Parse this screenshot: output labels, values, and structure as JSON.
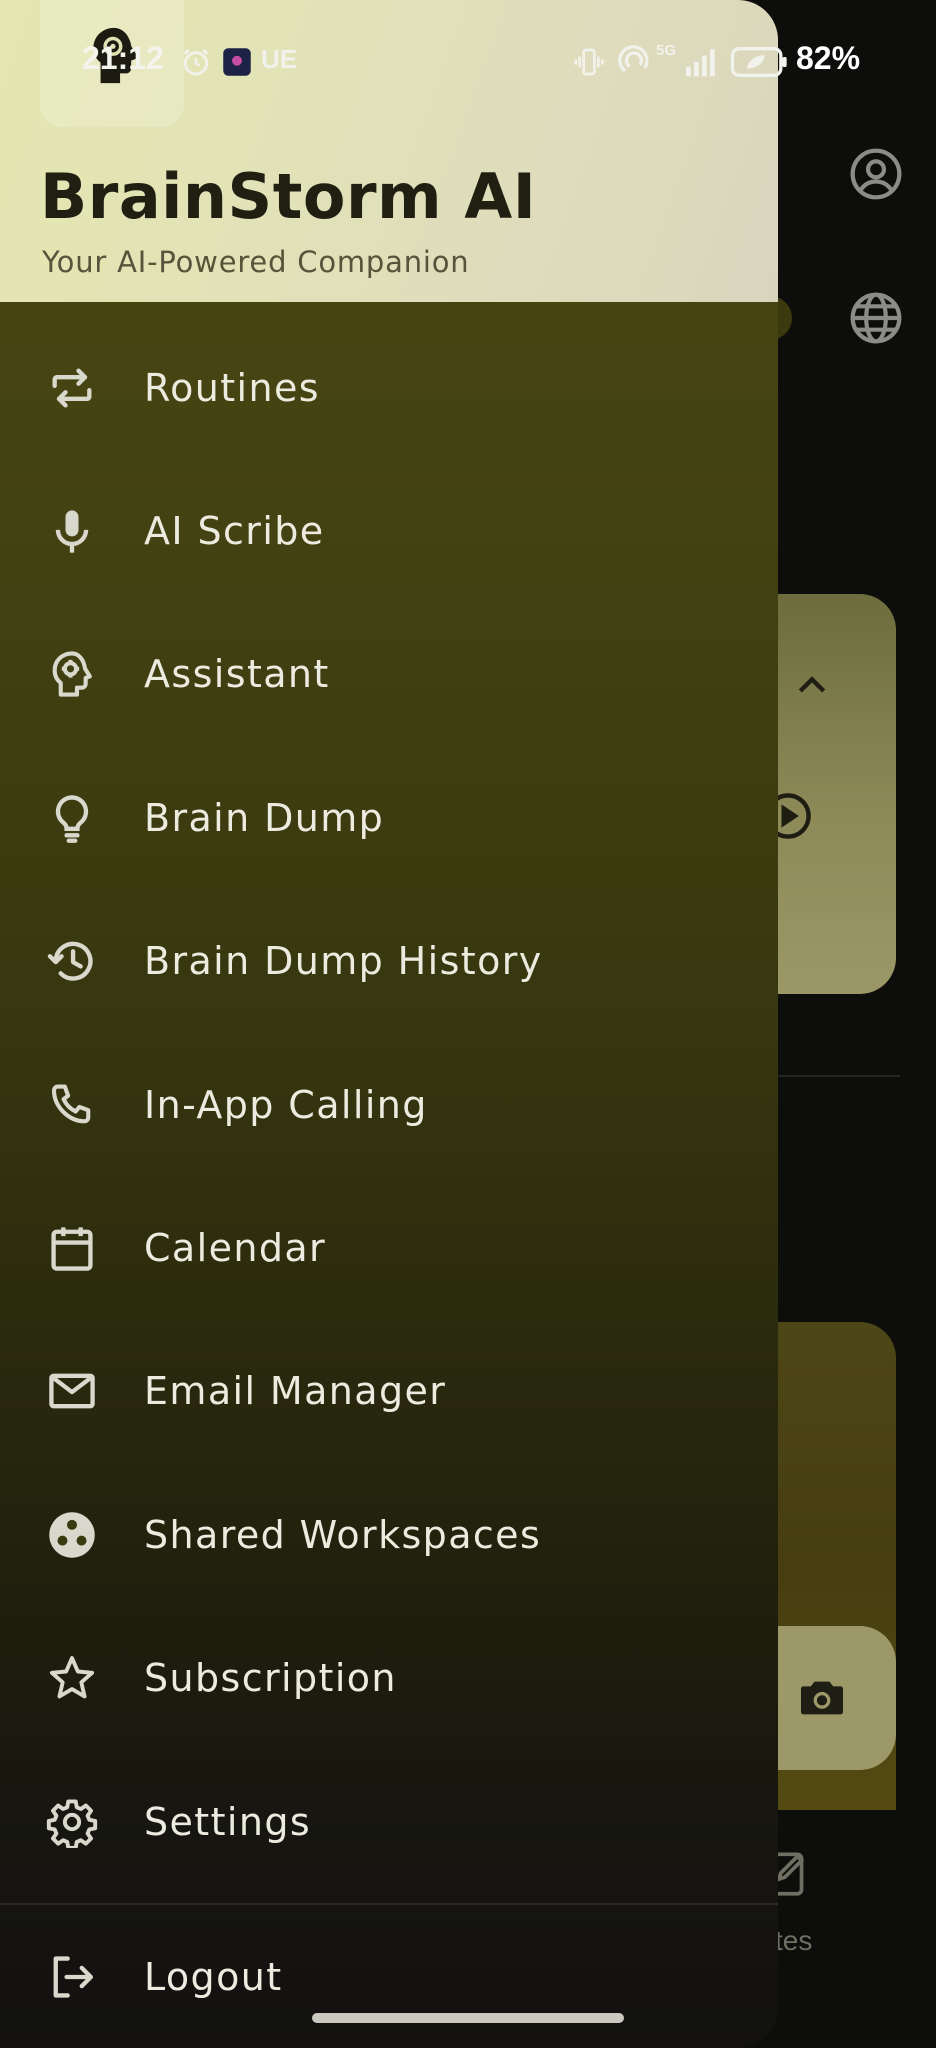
{
  "status_bar": {
    "time": "21:12",
    "carrier_tag": "UE",
    "network": "5G",
    "battery": "82%"
  },
  "drawer": {
    "brand_title": "BrainStorm AI",
    "brand_subtitle": "Your AI-Powered Companion",
    "menu_items": [
      {
        "label": "Routines",
        "icon": "repeat-icon"
      },
      {
        "label": "AI Scribe",
        "icon": "microphone-icon"
      },
      {
        "label": "Assistant",
        "icon": "brain-head-icon"
      },
      {
        "label": "Brain Dump",
        "icon": "lightbulb-icon"
      },
      {
        "label": "Brain Dump History",
        "icon": "history-icon"
      },
      {
        "label": "In-App Calling",
        "icon": "phone-icon"
      },
      {
        "label": "Calendar",
        "icon": "calendar-icon"
      },
      {
        "label": "Email Manager",
        "icon": "mail-icon"
      },
      {
        "label": "Shared Workspaces",
        "icon": "workspaces-icon"
      },
      {
        "label": "Subscription",
        "icon": "star-icon"
      },
      {
        "label": "Settings",
        "icon": "gear-icon"
      }
    ],
    "logout_label": "Logout"
  },
  "background_app": {
    "bottom_tab_partial": "tes"
  },
  "colors": {
    "header_bg": "#e2e3b6",
    "drawer_top": "#4a4a12",
    "drawer_bottom": "#121110",
    "menu_text": "#ecebdf"
  }
}
